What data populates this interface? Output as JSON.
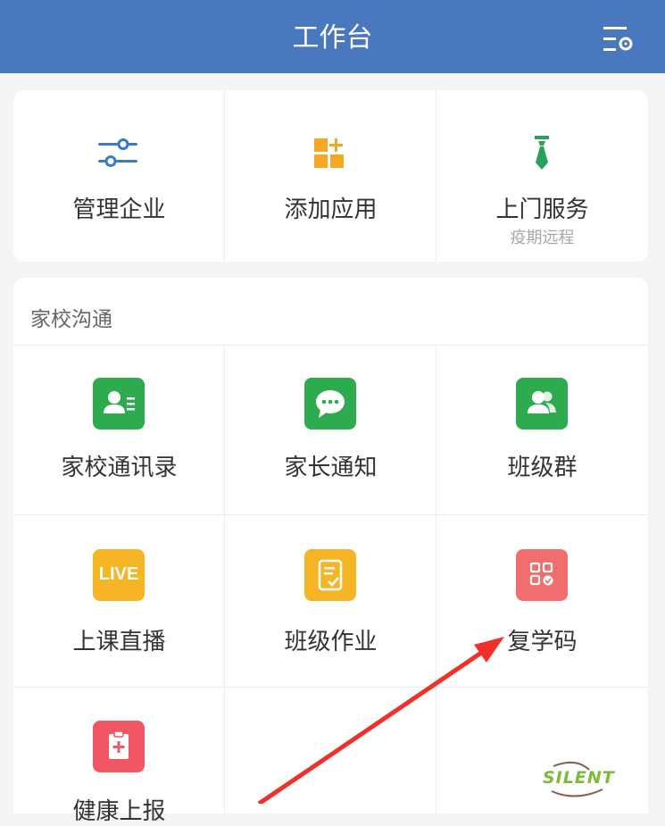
{
  "header": {
    "title": "工作台"
  },
  "top_card": {
    "items": [
      {
        "label": "管理企业",
        "sub": ""
      },
      {
        "label": "添加应用",
        "sub": ""
      },
      {
        "label": "上门服务",
        "sub": "疫期远程"
      }
    ]
  },
  "section": {
    "title": "家校沟通",
    "apps": [
      {
        "label": "家校通讯录",
        "icon": "contacts-icon",
        "color": "#2eab4f"
      },
      {
        "label": "家长通知",
        "icon": "chat-bubble-icon",
        "color": "#2eab4f"
      },
      {
        "label": "班级群",
        "icon": "group-icon",
        "color": "#2eab4f"
      },
      {
        "label": "上课直播",
        "icon": "live-icon",
        "icon_text": "LIVE",
        "color": "#f5b524"
      },
      {
        "label": "班级作业",
        "icon": "homework-icon",
        "color": "#f5b524"
      },
      {
        "label": "复学码",
        "icon": "qr-code-icon",
        "color": "#f26d6d"
      },
      {
        "label": "健康上报",
        "icon": "health-report-icon",
        "color": "#f05663"
      }
    ]
  },
  "colors": {
    "header": "#4a78bf",
    "blue_icon": "#3a7ac6",
    "orange_icon": "#f5a623",
    "tie_icon": "#2ba05e",
    "arrow": "#f0302a"
  },
  "watermark": {
    "text": "SILENT"
  }
}
